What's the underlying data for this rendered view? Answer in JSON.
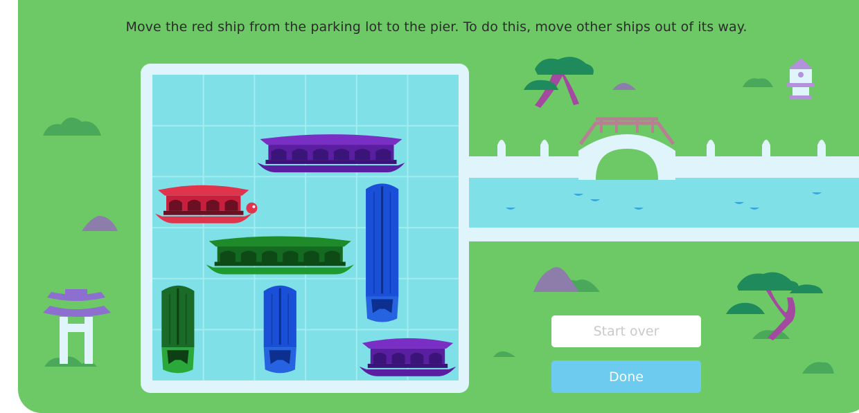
{
  "instruction": "Move the red ship from the parking lot to the pier. To do this, move other ships out of its way.",
  "buttons": {
    "start_over": "Start over",
    "done": "Done"
  },
  "board": {
    "rows": 6,
    "cols": 6,
    "exit_row": 3,
    "ships": [
      {
        "id": "ship-purple-long",
        "color": "purple",
        "orientation": "horizontal",
        "row": 2,
        "col": 3,
        "length": 3
      },
      {
        "id": "ship-red-target",
        "color": "red",
        "orientation": "horizontal",
        "row": 3,
        "col": 1,
        "length": 2
      },
      {
        "id": "ship-blue-tall",
        "color": "blue",
        "orientation": "vertical",
        "row": 3,
        "col": 5,
        "length": 3
      },
      {
        "id": "ship-green-long",
        "color": "green",
        "orientation": "horizontal",
        "row": 4,
        "col": 2,
        "length": 3
      },
      {
        "id": "ship-darkgreen-vertical",
        "color": "dark-green",
        "orientation": "vertical",
        "row": 5,
        "col": 1,
        "length": 2
      },
      {
        "id": "ship-blue-short",
        "color": "blue",
        "orientation": "vertical",
        "row": 5,
        "col": 3,
        "length": 2
      },
      {
        "id": "ship-purple-short",
        "color": "purple",
        "orientation": "horizontal",
        "row": 6,
        "col": 5,
        "length": 2
      }
    ]
  },
  "colors": {
    "background_green": "#6dc866",
    "water": "#7fe0e8",
    "frame": "#dff4fb",
    "red": "#e0334c",
    "purple": "#7a2fc4",
    "blue": "#1a4fd8",
    "green": "#1f8a2a",
    "dark_green": "#15612a",
    "done_button": "#6ccbef"
  }
}
